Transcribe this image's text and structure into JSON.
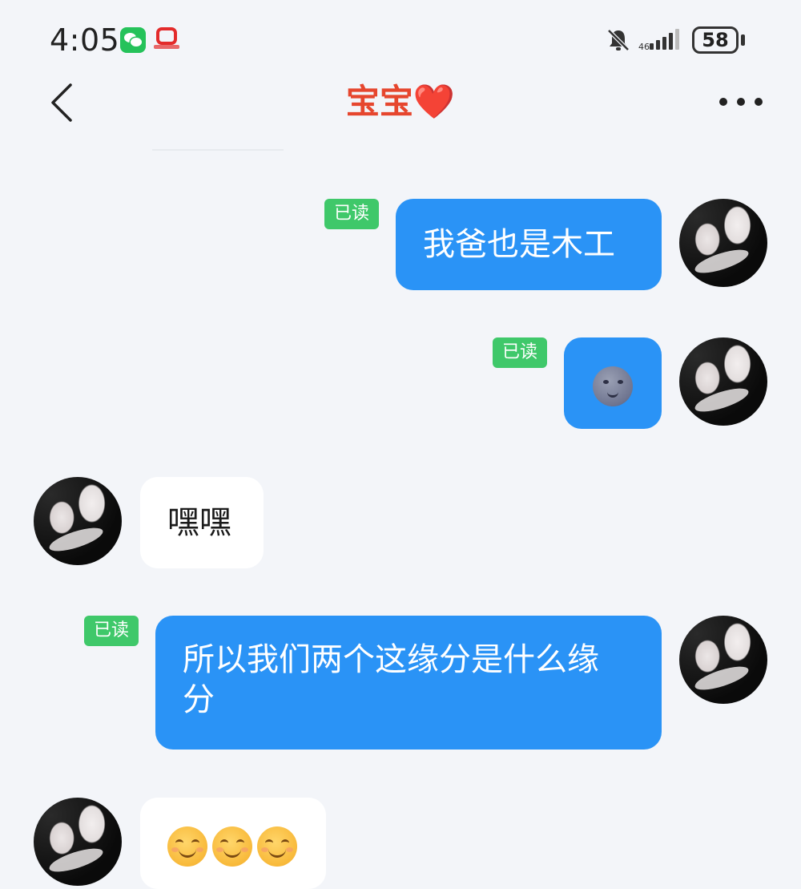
{
  "status_bar": {
    "time": "4:05",
    "battery": "58",
    "icons": [
      "wechat-icon",
      "news-app-icon",
      "mute-bell-icon",
      "signal-icon",
      "battery-icon"
    ]
  },
  "header": {
    "title": "宝宝",
    "title_emoji": "❤️",
    "title_color": "#e6462e",
    "back_icon": "chevron-left-icon",
    "more_icon": "more-dots-icon"
  },
  "messages": [
    {
      "direction": "out",
      "text": "我爸也是木工",
      "read_label": "已读"
    },
    {
      "direction": "out",
      "emoji": "new-moon-face-icon",
      "read_label": "已读"
    },
    {
      "direction": "in",
      "text": "嘿嘿"
    },
    {
      "direction": "out",
      "text": "所以我们两个这缘分是什么缘分",
      "read_label": "已读"
    },
    {
      "direction": "in",
      "emoji": "smiling-face-icon ×3"
    }
  ],
  "colors": {
    "outgoing_bubble": "#2a93f6",
    "incoming_bubble": "#ffffff",
    "read_badge": "#3fc86a",
    "background": "#f3f5f9"
  }
}
